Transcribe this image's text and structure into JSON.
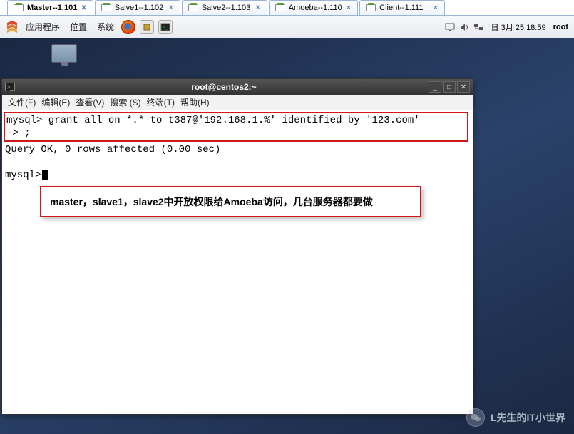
{
  "tabs": [
    {
      "label": "Master--1.101",
      "active": true
    },
    {
      "label": "Salve1--1.102",
      "active": false
    },
    {
      "label": "Salve2--1.103",
      "active": false
    },
    {
      "label": "Amoeba--1.110",
      "active": false
    },
    {
      "label": "Client--1.111",
      "active": false
    }
  ],
  "panel": {
    "apps": "应用程序",
    "places": "位置",
    "system": "系统",
    "clock": "日 3月 25 18:59",
    "user": "root"
  },
  "terminal": {
    "title": "root@centos2:~",
    "menu": {
      "file": "文件(F)",
      "edit": "编辑(E)",
      "view": "查看(V)",
      "search": "搜索 (S)",
      "terminal": "终端(T)",
      "help": "帮助(H)"
    },
    "line1": "mysql> grant all on *.* to t387@'192.168.1.%' identified by '123.com'",
    "line2": "    -> ;",
    "query_ok": "Query OK, 0 rows affected (0.00 sec)",
    "prompt": "mysql> "
  },
  "callout": "master，slave1，slave2中开放权限给Amoeba访问，几台服务器都要做",
  "watermark": "L先生的IT小世界"
}
